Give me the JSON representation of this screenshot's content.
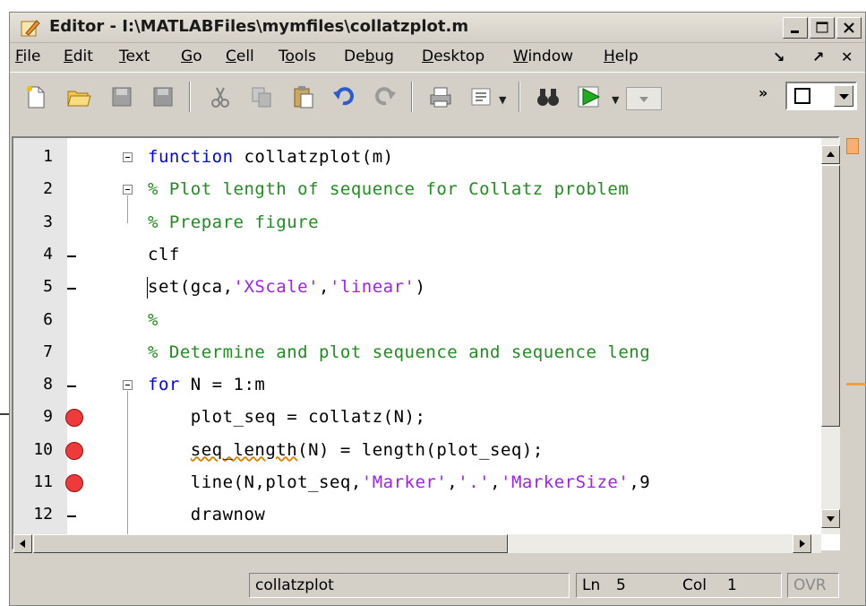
{
  "window": {
    "title": "Editor - I:\\MATLABFiles\\mymfiles\\collatzplot.m"
  },
  "menu": {
    "items": [
      {
        "label": "File",
        "u": "F",
        "rest": "ile"
      },
      {
        "label": "Edit",
        "u": "E",
        "rest": "dit"
      },
      {
        "label": "Text",
        "u": "T",
        "rest": "ext"
      },
      {
        "label": "Go",
        "u": "G",
        "rest": "o"
      },
      {
        "label": "Cell",
        "u": "C",
        "rest": "ell"
      },
      {
        "label": "Tools",
        "pre": "T",
        "u": "o",
        "rest": "ols"
      },
      {
        "label": "Debug",
        "pre": "De",
        "u": "b",
        "rest": "ug"
      },
      {
        "label": "Desktop",
        "u": "D",
        "rest": "esktop"
      },
      {
        "label": "Window",
        "u": "W",
        "rest": "indow"
      },
      {
        "label": "Help",
        "u": "H",
        "rest": "elp"
      }
    ],
    "right_glyphs": [
      "↘",
      "↗",
      "✕"
    ]
  },
  "editor": {
    "line_numbers": [
      "1",
      "2",
      "3",
      "4",
      "5",
      "6",
      "7",
      "8",
      "9",
      "10",
      "11",
      "12"
    ],
    "breakpoint_lines": [
      9,
      10,
      11
    ],
    "executable_dash_lines": [
      4,
      5,
      8,
      12
    ],
    "lines": [
      {
        "n": 1,
        "parts": [
          {
            "t": "function",
            "c": "kw"
          },
          {
            "t": " collatzplot(m)",
            "c": ""
          }
        ]
      },
      {
        "n": 2,
        "parts": [
          {
            "t": "% Plot length of sequence for Collatz problem",
            "c": "cm"
          }
        ]
      },
      {
        "n": 3,
        "parts": [
          {
            "t": "% Prepare figure",
            "c": "cm"
          }
        ]
      },
      {
        "n": 4,
        "parts": [
          {
            "t": "clf",
            "c": ""
          }
        ]
      },
      {
        "n": 5,
        "parts": [
          {
            "t": "set(gca,",
            "c": ""
          },
          {
            "t": "'XScale'",
            "c": "st"
          },
          {
            "t": ",",
            "c": ""
          },
          {
            "t": "'linear'",
            "c": "st"
          },
          {
            "t": ")",
            "c": ""
          }
        ]
      },
      {
        "n": 6,
        "parts": [
          {
            "t": "%",
            "c": "cm"
          }
        ]
      },
      {
        "n": 7,
        "parts": [
          {
            "t": "% Determine and plot sequence and sequence leng",
            "c": "cm"
          }
        ]
      },
      {
        "n": 8,
        "parts": [
          {
            "t": "for",
            "c": "kw"
          },
          {
            "t": " N = 1:m",
            "c": ""
          }
        ]
      },
      {
        "n": 9,
        "parts": [
          {
            "t": "    plot_seq = collatz(N);",
            "c": ""
          }
        ]
      },
      {
        "n": 10,
        "parts": [
          {
            "t": "    ",
            "c": ""
          },
          {
            "t": "seq_length",
            "c": "squig"
          },
          {
            "t": "(N) = length(plot_seq);",
            "c": ""
          }
        ]
      },
      {
        "n": 11,
        "parts": [
          {
            "t": "    line(N,plot_seq,",
            "c": ""
          },
          {
            "t": "'Marker'",
            "c": "st"
          },
          {
            "t": ",",
            "c": ""
          },
          {
            "t": "'.'",
            "c": "st"
          },
          {
            "t": ",",
            "c": ""
          },
          {
            "t": "'MarkerSize'",
            "c": "st"
          },
          {
            "t": ",9",
            "c": ""
          }
        ]
      },
      {
        "n": 12,
        "parts": [
          {
            "t": "    drawnow",
            "c": ""
          }
        ]
      }
    ]
  },
  "status": {
    "function_name": "collatzplot",
    "ln_label": "Ln",
    "ln_value": "5",
    "col_label": "Col",
    "col_value": "1",
    "ovr": "OVR"
  },
  "colors": {
    "keyword": "#0000ff",
    "comment": "#228b22",
    "string": "#a020f0",
    "breakpoint": "#ee3a3a"
  }
}
